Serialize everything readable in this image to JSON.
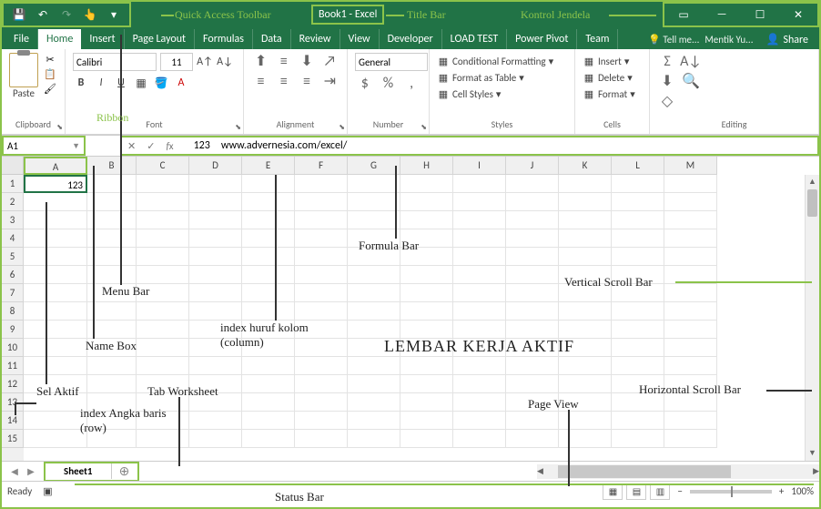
{
  "titlebar": {
    "title": "Book1 - Excel"
  },
  "annotations": {
    "qat": "Quick Access Toolbar",
    "titlebar": "Title Bar",
    "window_controls": "Kontrol Jendela",
    "ribbon": "Ribbon",
    "menu_bar": "Menu Bar",
    "name_box": "Name Box",
    "formula_bar": "Formula Bar",
    "active_cell": "Sel Aktif",
    "column_index": "index huruf kolom (column)",
    "row_index": "index Angka baris (row)",
    "tab_worksheet": "Tab Worksheet",
    "status_bar": "Status Bar",
    "page_view": "Page View",
    "vscroll": "Vertical Scroll Bar",
    "hscroll": "Horizontal Scroll Bar",
    "active_sheet": "LEMBAR KERJA AKTIF"
  },
  "tabs": {
    "file": "File",
    "home": "Home",
    "insert": "Insert",
    "page_layout": "Page Layout",
    "formulas": "Formulas",
    "data": "Data",
    "review": "Review",
    "view": "View",
    "developer": "Developer",
    "load_test": "LOAD TEST",
    "power_pivot": "Power Pivot",
    "team": "Team",
    "tell_me": "Tell me...",
    "user": "Mentik Yu...",
    "share": "Share"
  },
  "ribbon": {
    "clipboard": {
      "paste": "Paste",
      "label": "Clipboard"
    },
    "font": {
      "name": "Calibri",
      "size": "11",
      "label": "Font"
    },
    "alignment": {
      "label": "Alignment"
    },
    "number": {
      "format": "General",
      "label": "Number"
    },
    "styles": {
      "cond_fmt": "Conditional Formatting",
      "fmt_table": "Format as Table",
      "cell_styles": "Cell Styles",
      "label": "Styles"
    },
    "cells": {
      "insert": "Insert",
      "delete": "Delete",
      "format": "Format",
      "label": "Cells"
    },
    "editing": {
      "label": "Editing"
    }
  },
  "name_box": {
    "value": "A1"
  },
  "formula_bar": {
    "value_a": "123",
    "value_b": "www.advernesia.com/excel/"
  },
  "grid": {
    "columns": [
      "A",
      "B",
      "C",
      "D",
      "E",
      "F",
      "G",
      "H",
      "I",
      "J",
      "K",
      "L",
      "M"
    ],
    "rows": [
      "1",
      "2",
      "3",
      "4",
      "5",
      "6",
      "7",
      "8",
      "9",
      "10",
      "11",
      "12",
      "13",
      "14",
      "15"
    ],
    "active_cell_value": "123"
  },
  "sheet": {
    "name": "Sheet1"
  },
  "status": {
    "ready": "Ready",
    "zoom": "100%"
  }
}
